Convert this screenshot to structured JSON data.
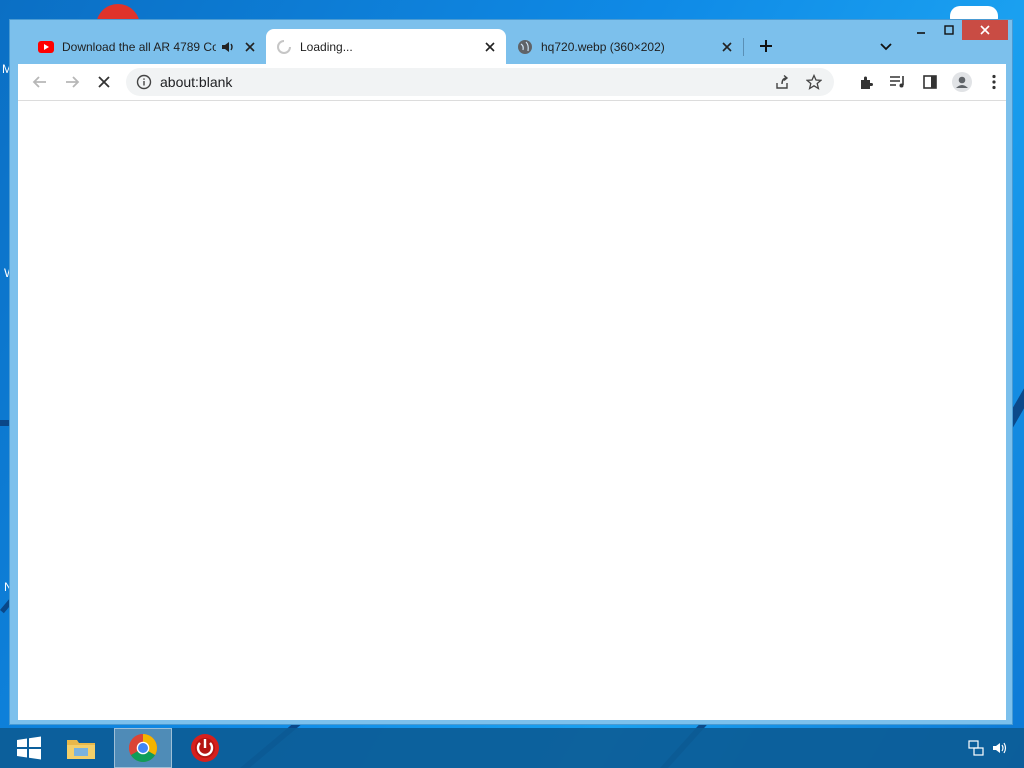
{
  "browser": {
    "tabs": [
      {
        "title": "Download the all AR 4789 Co",
        "favicon": "youtube-icon",
        "audio": "speaker-icon",
        "active": false
      },
      {
        "title": "Loading...",
        "favicon": "loading-spinner-icon",
        "active": true
      },
      {
        "title": "hq720.webp (360×202)",
        "favicon": "globe-icon",
        "active": false
      }
    ],
    "address": {
      "url": "about:blank",
      "security_icon": "info-icon"
    },
    "toolbar_icons": [
      "back-icon",
      "forward-icon",
      "stop-icon",
      "share-icon",
      "star-icon",
      "extensions-icon",
      "media-queue-icon",
      "side-panel-icon",
      "profile-icon",
      "menu-icon"
    ],
    "window_controls": [
      "minimize",
      "maximize",
      "close"
    ]
  },
  "desktop": {
    "peek_letters": [
      "M",
      "W",
      "N"
    ]
  },
  "taskbar": {
    "apps": [
      "windows-start-icon",
      "file-explorer-icon",
      "chrome-icon",
      "power-app-icon"
    ],
    "tray": [
      "network-icon",
      "volume-icon"
    ]
  },
  "colors": {
    "accent": "#c94c44",
    "titlebar": "#7cc0ec",
    "youtube_red": "#ff0000"
  }
}
